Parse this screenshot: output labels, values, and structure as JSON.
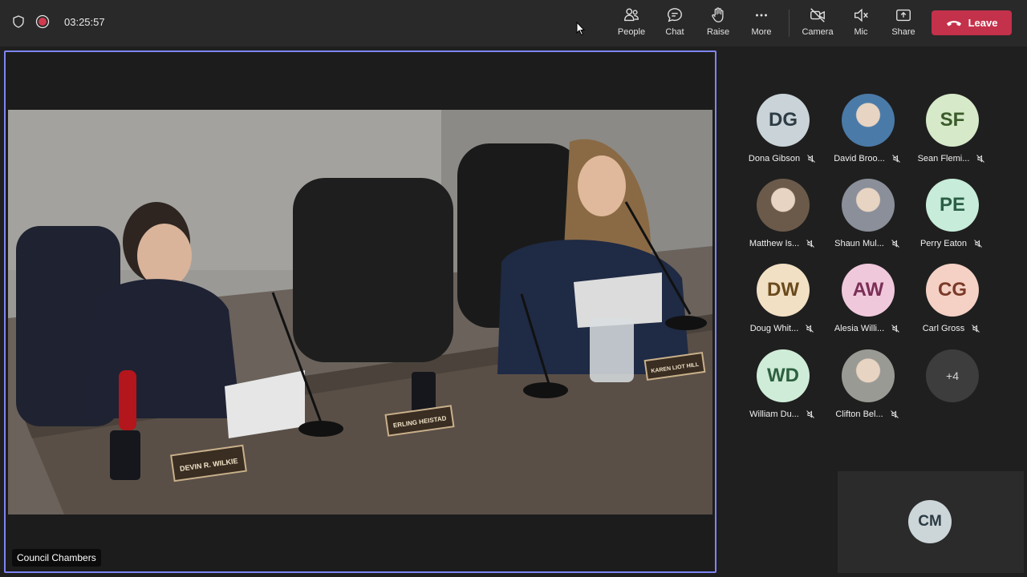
{
  "toolbar": {
    "timer": "03:25:57",
    "people_label": "People",
    "chat_label": "Chat",
    "raise_label": "Raise",
    "more_label": "More",
    "camera_label": "Camera",
    "mic_label": "Mic",
    "share_label": "Share",
    "leave_label": "Leave"
  },
  "stage": {
    "label": "Council Chambers",
    "nameplates": [
      "DEVIN R. WILKIE",
      "ERLING HEISTAD",
      "KAREN LIOT HILL"
    ]
  },
  "participants": [
    {
      "initials": "DG",
      "name": "Dona Gibson",
      "bg": "#c9d3d8",
      "fg": "#2e3d45",
      "photo": false
    },
    {
      "initials": "",
      "name": "David Broo...",
      "bg": "#4a7aa8",
      "fg": "#ffffff",
      "photo": true
    },
    {
      "initials": "SF",
      "name": "Sean Flemi...",
      "bg": "#d6e9c9",
      "fg": "#3a5a2a",
      "photo": false
    },
    {
      "initials": "",
      "name": "Matthew Is...",
      "bg": "#6b5a4a",
      "fg": "#ffffff",
      "photo": true
    },
    {
      "initials": "",
      "name": "Shaun Mul...",
      "bg": "#8a8f99",
      "fg": "#ffffff",
      "photo": true
    },
    {
      "initials": "PE",
      "name": "Perry Eaton",
      "bg": "#c7ecd9",
      "fg": "#2a5e45",
      "photo": false
    },
    {
      "initials": "DW",
      "name": "Doug Whit...",
      "bg": "#f2e0c4",
      "fg": "#6a4a1c",
      "photo": false
    },
    {
      "initials": "AW",
      "name": "Alesia Willi...",
      "bg": "#f0c8dc",
      "fg": "#7a2f55",
      "photo": false
    },
    {
      "initials": "CG",
      "name": "Carl Gross",
      "bg": "#f5d0c5",
      "fg": "#7a3a28",
      "photo": false
    },
    {
      "initials": "WD",
      "name": "William Du...",
      "bg": "#cfecd8",
      "fg": "#2d6040",
      "photo": false
    },
    {
      "initials": "",
      "name": "Clifton Bel...",
      "bg": "#9a9a95",
      "fg": "#ffffff",
      "photo": true
    },
    {
      "initials": "+4",
      "name": "",
      "bg": "#3d3d3d",
      "fg": "#d6d6d6",
      "photo": false
    }
  ],
  "self_view": {
    "initials": "CM"
  },
  "colors": {
    "accent": "#7f85f5",
    "leave": "#c4314b",
    "topbar": "#292929",
    "background": "#1f1f1f"
  }
}
